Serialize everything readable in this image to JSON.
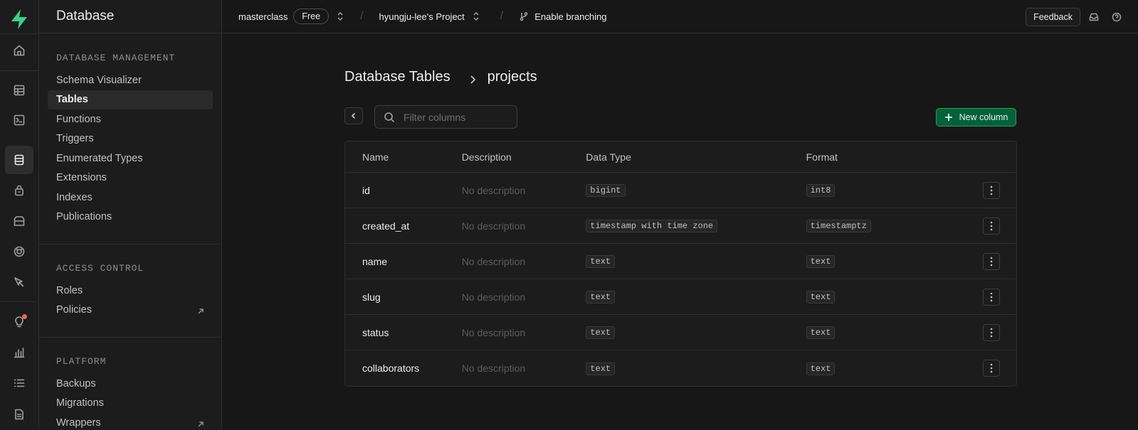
{
  "sidebar": {
    "title": "Database",
    "sections": [
      {
        "title": "DATABASE MANAGEMENT",
        "items": [
          {
            "label": "Schema Visualizer"
          },
          {
            "label": "Tables"
          },
          {
            "label": "Functions"
          },
          {
            "label": "Triggers"
          },
          {
            "label": "Enumerated Types"
          },
          {
            "label": "Extensions"
          },
          {
            "label": "Indexes"
          },
          {
            "label": "Publications"
          }
        ]
      },
      {
        "title": "ACCESS CONTROL",
        "items": [
          {
            "label": "Roles"
          },
          {
            "label": "Policies"
          }
        ]
      },
      {
        "title": "PLATFORM",
        "items": [
          {
            "label": "Backups"
          },
          {
            "label": "Migrations"
          },
          {
            "label": "Wrappers"
          }
        ]
      }
    ],
    "active_item": "Tables"
  },
  "topbar": {
    "org": "masterclass",
    "plan": "Free",
    "project": "hyungju-lee's Project",
    "branching": "Enable branching",
    "feedback": "Feedback"
  },
  "main": {
    "breadcrumb_root": "Database Tables",
    "breadcrumb_current": "projects",
    "search_placeholder": "Filter columns",
    "new_column": "New column",
    "columns": [
      "Name",
      "Description",
      "Data Type",
      "Format"
    ],
    "rows": [
      {
        "name": "id",
        "description": "No description",
        "type": "bigint",
        "format": "int8"
      },
      {
        "name": "created_at",
        "description": "No description",
        "type": "timestamp with time zone",
        "format": "timestamptz"
      },
      {
        "name": "name",
        "description": "No description",
        "type": "text",
        "format": "text"
      },
      {
        "name": "slug",
        "description": "No description",
        "type": "text",
        "format": "text"
      },
      {
        "name": "status",
        "description": "No description",
        "type": "text",
        "format": "text"
      },
      {
        "name": "collaborators",
        "description": "No description",
        "type": "text",
        "format": "text"
      }
    ]
  },
  "colors": {
    "background": "#171717",
    "panel": "#1c1c1c",
    "accent_green": "#006239",
    "logo_green": "#3ecf8e",
    "notification": "#e5684f"
  }
}
